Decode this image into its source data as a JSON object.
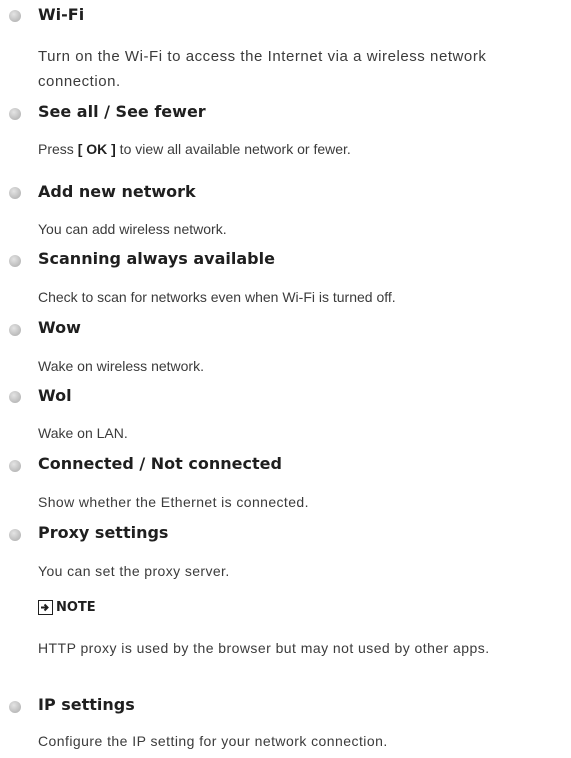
{
  "items": [
    {
      "title": "Wi-Fi",
      "desc": "Turn on the Wi-Fi to access the Internet via a wireless network connection."
    },
    {
      "title": "See all / See fewer",
      "desc_prefix": "Press ",
      "desc_key": "[ OK ]",
      "desc_suffix": " to view all available network or fewer."
    },
    {
      "title": "Add new network",
      "desc": "You can add wireless network."
    },
    {
      "title": "Scanning always available",
      "desc": "Check to scan for networks even when Wi-Fi is turned off."
    },
    {
      "title": "Wow",
      "desc": "Wake on wireless network."
    },
    {
      "title": "Wol",
      "desc": "Wake on LAN."
    },
    {
      "title": "Connected / Not connected",
      "desc": "Show whether the Ethernet is connected."
    },
    {
      "title": "Proxy settings",
      "desc": "You can set the proxy server."
    },
    {
      "title": "IP settings",
      "desc": "Configure the IP setting for your network connection."
    }
  ],
  "note": {
    "icon": "arrow-right-box-icon",
    "title": "NOTE",
    "text": "HTTP proxy is used by the browser but may not used by other apps."
  }
}
